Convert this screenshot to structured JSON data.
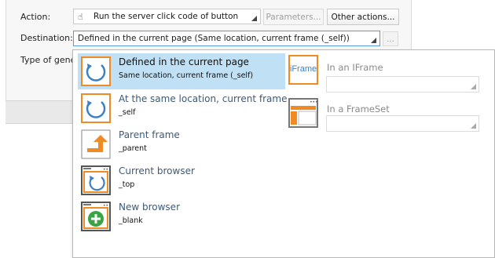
{
  "dialog": {
    "action_label": "Action:",
    "action_value": "Run the server click code of button",
    "parameters_button": "Parameters...",
    "other_actions_button": "Other actions...",
    "destination_label": "Destination:",
    "destination_value": "Defined in the current page (Same location, current frame (_self))",
    "ellipsis_button": "...",
    "type_label": "Type of genera"
  },
  "popup": {
    "options": [
      {
        "title": "Defined in the current page",
        "subtitle": "Same location, current frame (_self)",
        "icon": "refresh-frame-icon",
        "selected": true
      },
      {
        "title": "At the same location, current frame",
        "subtitle": "_self",
        "icon": "refresh-frame-icon",
        "selected": false
      },
      {
        "title": "Parent frame",
        "subtitle": "_parent",
        "icon": "parent-arrow-icon",
        "selected": false
      },
      {
        "title": "Current browser",
        "subtitle": "_top",
        "icon": "browser-refresh-icon",
        "selected": false
      },
      {
        "title": "New browser",
        "subtitle": "_blank",
        "icon": "new-browser-icon",
        "selected": false
      }
    ],
    "iframe_option": {
      "title": "In an IFrame",
      "icon_text": "iFrame",
      "icon": "iframe-icon",
      "value": ""
    },
    "frameset_option": {
      "title": "In a FrameSet",
      "icon": "frameset-icon",
      "value": ""
    }
  },
  "colors": {
    "accent_orange": "#f08a24",
    "icon_blue": "#3b82c4",
    "selection_blue": "#bfe0f5",
    "green": "#3aa344"
  }
}
